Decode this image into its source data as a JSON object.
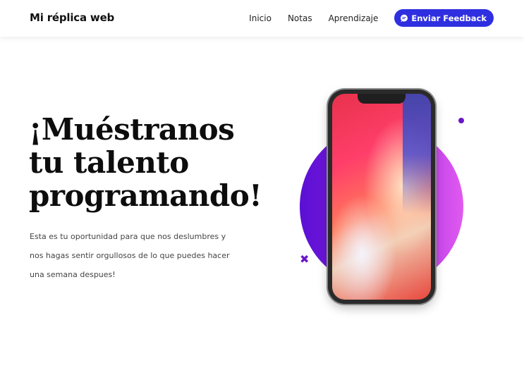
{
  "navbar": {
    "brand": "Mi réplica web",
    "links": [
      "Inicio",
      "Notas",
      "Aprendizaje"
    ],
    "feedback_button": "Enviar Feedback",
    "feedback_icon": "chat-icon"
  },
  "hero": {
    "headline_lines": [
      "¡Muéstranos",
      "tu talento",
      "programando!"
    ],
    "description": "Esta es tu oportunidad para que nos deslumbres y nos hagas sentir orgullosos de lo que puedes hacer una semana despues!",
    "decorations": {
      "cross_glyph": "✖"
    }
  },
  "colors": {
    "accent": "#2f2fe0",
    "purple": "#6a16c8",
    "gradient_start": "#5a10d4",
    "gradient_end": "#e15af0"
  }
}
